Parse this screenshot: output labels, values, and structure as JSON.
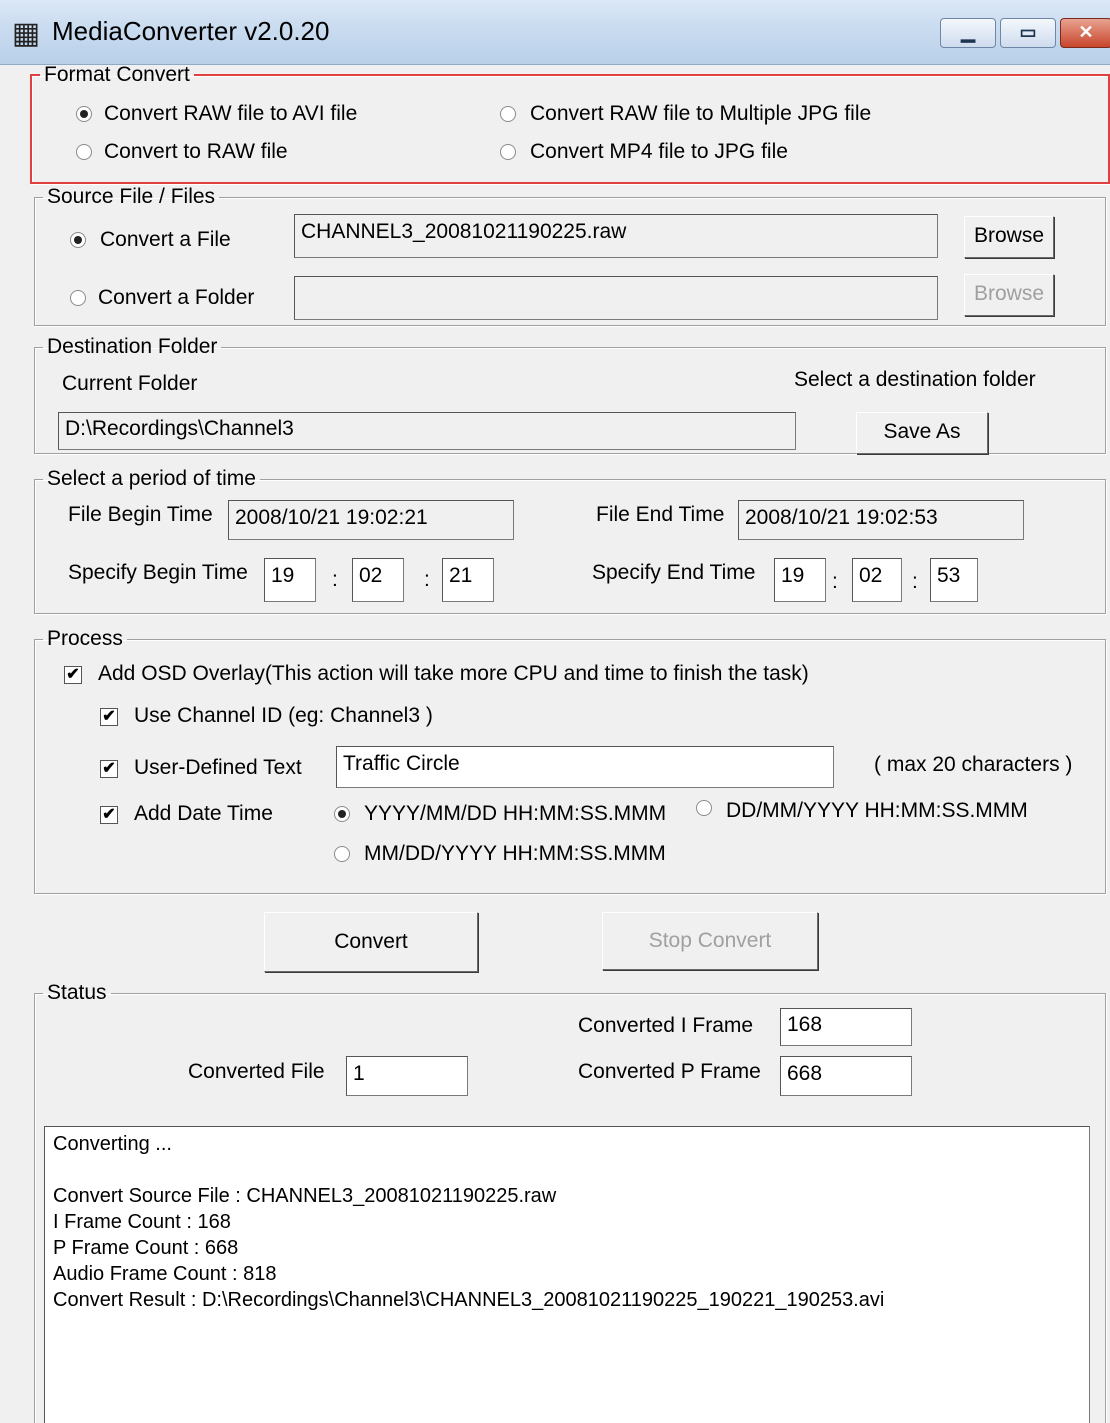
{
  "window": {
    "title": "MediaConverter v2.0.20",
    "app_icon": "app-icon-glyph"
  },
  "format_convert": {
    "legend": "Format Convert",
    "options": [
      {
        "label": "Convert RAW file to AVI file",
        "checked": true
      },
      {
        "label": "Convert RAW file to Multiple JPG file",
        "checked": false
      },
      {
        "label": "Convert to RAW file",
        "checked": false
      },
      {
        "label": "Convert MP4 file to JPG file",
        "checked": false
      }
    ]
  },
  "source": {
    "legend": "Source File / Files",
    "file_label": "Convert a File",
    "file_value": "CHANNEL3_20081021190225.raw",
    "folder_label": "Convert a Folder",
    "folder_value": "",
    "browse_label": "Browse"
  },
  "destination": {
    "legend": "Destination Folder",
    "current_label": "Current Folder",
    "select_label": "Select a destination folder",
    "path": "D:\\Recordings\\Channel3",
    "save_as_label": "Save As"
  },
  "period": {
    "legend": "Select a period of time",
    "begin_label": "File Begin Time",
    "begin_value": "2008/10/21 19:02:21",
    "end_label": "File End Time",
    "end_value": "2008/10/21 19:02:53",
    "spec_begin_label": "Specify Begin Time",
    "spec_end_label": "Specify End Time",
    "colon": ":",
    "begin_hh": "19",
    "begin_mm": "02",
    "begin_ss": "21",
    "end_hh": "19",
    "end_mm": "02",
    "end_ss": "53"
  },
  "process": {
    "legend": "Process",
    "osd_label": "Add OSD Overlay(This action will take more CPU and time to finish the task)",
    "channel_id_label": "Use Channel ID (eg: Channel3 )",
    "user_text_label": "User-Defined Text",
    "user_text_value": "Traffic Circle",
    "max_hint": "( max 20 characters )",
    "date_time_label": "Add Date Time",
    "date_formats": [
      {
        "label": "YYYY/MM/DD HH:MM:SS.MMM",
        "checked": true
      },
      {
        "label": "DD/MM/YYYY HH:MM:SS.MMM",
        "checked": false
      },
      {
        "label": "MM/DD/YYYY HH:MM:SS.MMM",
        "checked": false
      }
    ],
    "check_mark": "✔"
  },
  "actions": {
    "convert_label": "Convert",
    "stop_label": "Stop Convert"
  },
  "status": {
    "legend": "Status",
    "i_frame_label": "Converted I Frame",
    "i_frame_value": "168",
    "file_label": "Converted File",
    "file_value": "1",
    "p_frame_label": "Converted P Frame",
    "p_frame_value": "668",
    "log": [
      "Converting ...",
      "",
      "Convert Source File : CHANNEL3_20081021190225.raw",
      "I Frame Count : 168",
      "P Frame Count : 668",
      "Audio Frame Count : 818",
      "Convert Result : D:\\Recordings\\Channel3\\CHANNEL3_20081021190225_190221_190253.avi"
    ]
  }
}
